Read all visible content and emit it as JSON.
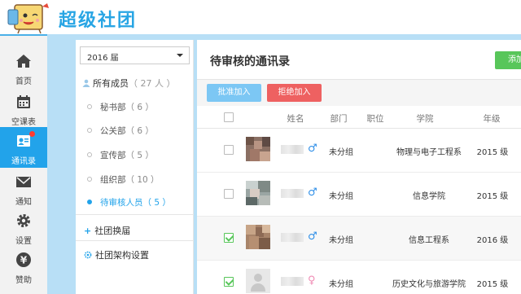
{
  "app": {
    "brand": "超级社团",
    "colors": {
      "primary": "#22a3ea",
      "accent_green": "#58c65a",
      "danger": "#ee6161",
      "approve": "#7cc7f4",
      "gutter": "#b8dff6"
    }
  },
  "nav": {
    "items": [
      {
        "label": "首页",
        "icon": "home-icon"
      },
      {
        "label": "空课表",
        "icon": "calendar-icon"
      },
      {
        "label": "通讯录",
        "icon": "contacts-icon",
        "active": true,
        "badge": true
      },
      {
        "label": "通知",
        "icon": "mail-icon"
      },
      {
        "label": "设置",
        "icon": "gear-icon"
      },
      {
        "label": "赞助",
        "icon": "yen-icon"
      }
    ]
  },
  "panel": {
    "year_select": "2016 届",
    "all_members": {
      "label": "所有成员",
      "count": "（ 27 人 ）"
    },
    "departments": [
      {
        "label": "秘书部",
        "count": "（ 6 ）"
      },
      {
        "label": "公关部",
        "count": "（ 6 ）"
      },
      {
        "label": "宣传部",
        "count": "（ 5 ）"
      },
      {
        "label": "组织部",
        "count": "（ 10 ）"
      },
      {
        "label": "待审核人员",
        "count": "（ 5 ）",
        "active": true
      }
    ],
    "links": [
      {
        "label": "社团换届",
        "icon": "plus-icon"
      },
      {
        "label": "社团架构设置",
        "icon": "gear-icon"
      }
    ]
  },
  "main": {
    "title": "待审核的通讯录",
    "add_button": "添加",
    "approve_button": "批准加入",
    "reject_button": "拒绝加入",
    "columns": [
      "姓名",
      "部门",
      "职位",
      "学院",
      "年级"
    ],
    "rows": [
      {
        "checked": false,
        "gender": "♂",
        "gender_type": "male",
        "department": "未分组",
        "position": "",
        "college": "物理与电子工程系",
        "grade": "2015 级",
        "avatar": "blurred"
      },
      {
        "checked": false,
        "gender": "♂",
        "gender_type": "male",
        "department": "未分组",
        "position": "",
        "college": "信息学院",
        "grade": "2015 级",
        "avatar": "blurred"
      },
      {
        "checked": true,
        "gender": "♂",
        "gender_type": "male",
        "department": "未分组",
        "position": "",
        "college": "信息工程系",
        "grade": "2016 级",
        "avatar": "blurred"
      },
      {
        "checked": true,
        "gender": "♀",
        "gender_type": "female",
        "department": "未分组",
        "position": "",
        "college": "历史文化与旅游学院",
        "grade": "2015 级",
        "avatar": "placeholder"
      }
    ]
  }
}
